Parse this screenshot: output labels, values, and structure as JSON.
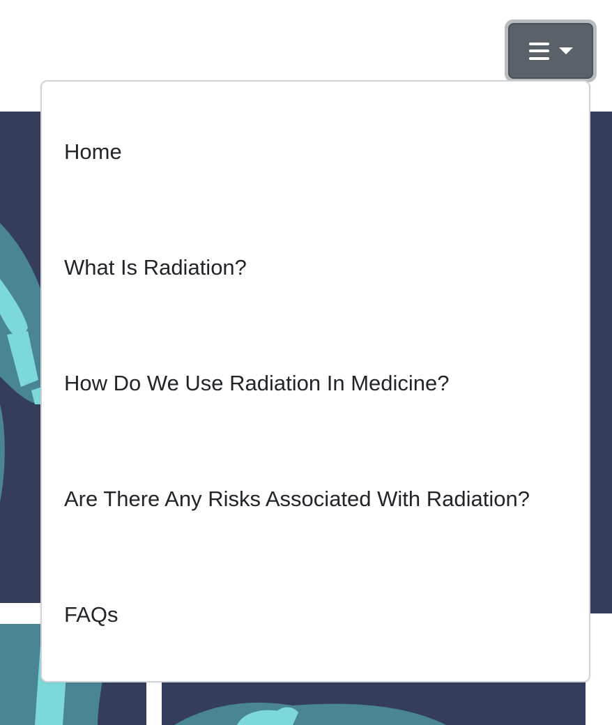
{
  "toggle": {
    "icon": "hamburger-icon",
    "caret_icon": "caret-down-icon"
  },
  "menu": {
    "items": [
      {
        "label": "Home"
      },
      {
        "label": "What Is Radiation?"
      },
      {
        "label": "How Do We Use Radiation In Medicine?"
      },
      {
        "label": "Are There Any Risks Associated With Radiation?"
      },
      {
        "label": "FAQs"
      }
    ]
  },
  "colors": {
    "hero_background": "#343e5b",
    "xray_bone_light": "#7dd8d9",
    "xray_bone_mid": "#4a8593",
    "toggle_bg": "#5a6168",
    "toggle_ring": "#b7bcc1",
    "menu_text": "#212529"
  }
}
